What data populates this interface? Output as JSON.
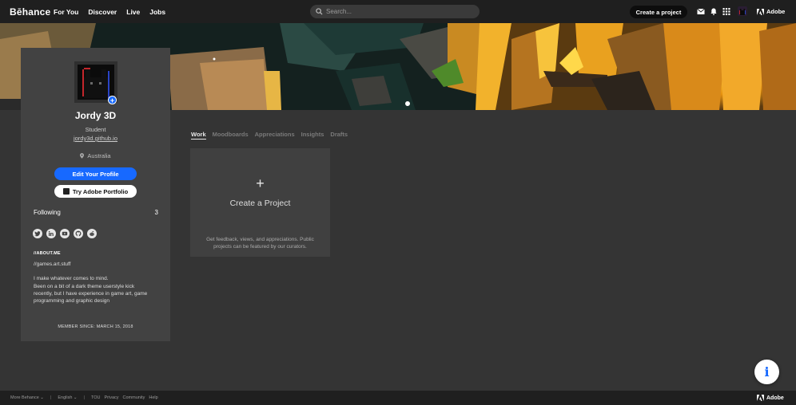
{
  "nav": {
    "logo": "Bēhance",
    "links": [
      "For You",
      "Discover",
      "Live",
      "Jobs"
    ],
    "search_placeholder": "Search...",
    "create_label": "Create a project",
    "adobe_label": "Adobe"
  },
  "profile": {
    "name": "Jordy 3D",
    "occupation": "Student",
    "website": "jordy3d.github.io",
    "location": "Australia",
    "edit_label": "Edit Your Profile",
    "portfolio_label": "Try Adobe Portfolio",
    "following_label": "Following",
    "following_count": "3",
    "about_heading": "//ABOUT.ME",
    "about_lines": [
      "//games.art.stuff",
      "",
      "I make whatever comes to mind.",
      "Been on a bit of a dark theme userstyle kick",
      "recently, but I have experience in game art, game",
      "programming and graphic design"
    ],
    "member_since": "MEMBER SINCE: MARCH 15, 2018"
  },
  "tabs": [
    "Work",
    "Moodboards",
    "Appreciations",
    "Insights",
    "Drafts"
  ],
  "create_card": {
    "plus": "+",
    "title": "Create a Project",
    "desc_line1": "Get feedback, views, and appreciations. Public",
    "desc_line2": "projects can be featured by our curators."
  },
  "info_glyph": "i",
  "footer": {
    "more": "More Behance ⌄",
    "language": "English ⌄",
    "links": [
      "TOU",
      "Privacy",
      "Community",
      "Help"
    ],
    "adobe_label": "Adobe"
  },
  "colors": {
    "accent": "#1769ff",
    "background": "#343434",
    "card": "#424242"
  }
}
